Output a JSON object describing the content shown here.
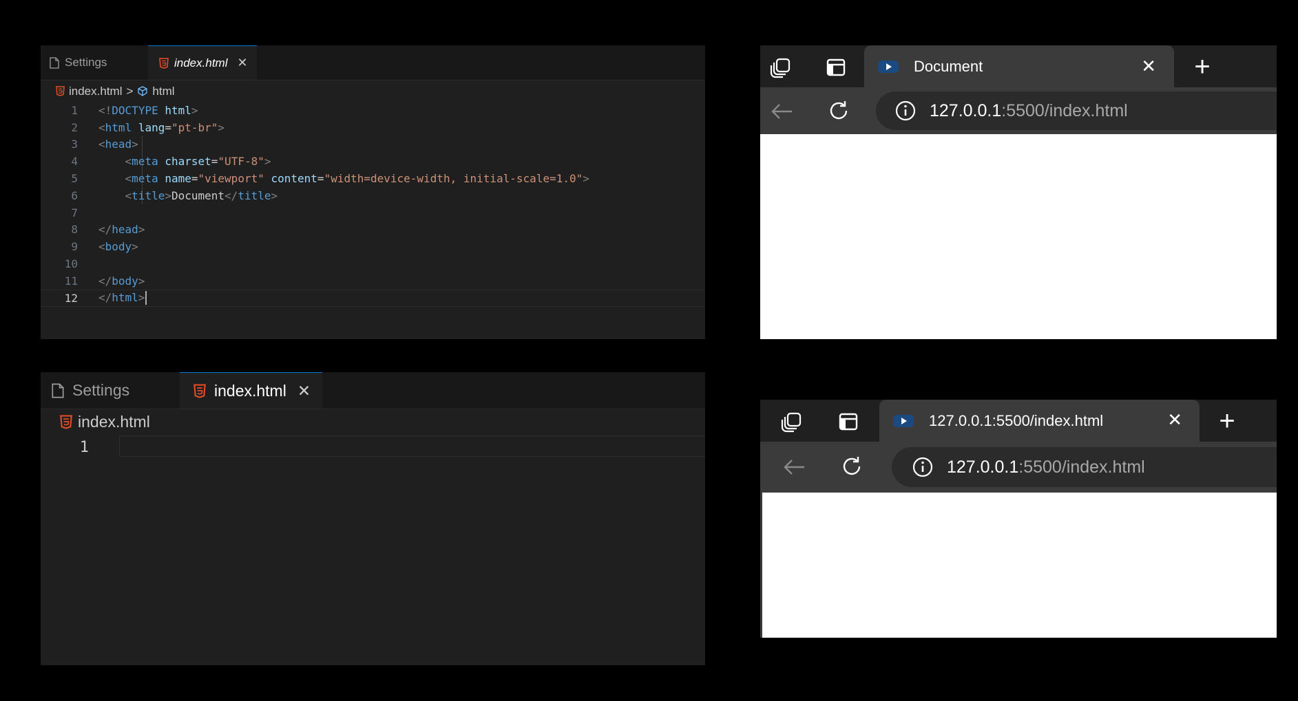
{
  "editor_top": {
    "tabs": [
      {
        "label": "Settings",
        "icon": "file-icon",
        "active": false
      },
      {
        "label": "index.html",
        "icon": "html5-icon",
        "active": true,
        "close": "✕"
      }
    ],
    "breadcrumb": {
      "file": "index.html",
      "separator": ">",
      "element": "html"
    },
    "lines": [
      {
        "n": "1",
        "code": "<!DOCTYPE html>"
      },
      {
        "n": "2",
        "code": "<html lang=\"pt-br\">"
      },
      {
        "n": "3",
        "code": "<head>"
      },
      {
        "n": "4",
        "code": "    <meta charset=\"UTF-8\">"
      },
      {
        "n": "5",
        "code": "    <meta name=\"viewport\" content=\"width=device-width, initial-scale=1.0\">"
      },
      {
        "n": "6",
        "code": "    <title>Document</title>"
      },
      {
        "n": "7",
        "code": ""
      },
      {
        "n": "8",
        "code": "</head>"
      },
      {
        "n": "9",
        "code": "<body>"
      },
      {
        "n": "10",
        "code": ""
      },
      {
        "n": "11",
        "code": "</body>"
      },
      {
        "n": "12",
        "code": "</html>"
      }
    ],
    "current_line": "12"
  },
  "editor_bottom": {
    "tabs": [
      {
        "label": "Settings",
        "icon": "file-icon",
        "active": false
      },
      {
        "label": "index.html",
        "icon": "html5-icon",
        "active": true,
        "close": "✕"
      }
    ],
    "breadcrumb": {
      "file": "index.html"
    },
    "lines": [
      {
        "n": "1",
        "code": ""
      }
    ]
  },
  "browser_top": {
    "tab_title": "Document",
    "tab_close": "✕",
    "new_tab": "+",
    "url_host": "127.0.0.1",
    "url_rest": ":5500/index.html"
  },
  "browser_bottom": {
    "tab_title": "127.0.0.1:5500/index.html",
    "tab_close": "✕",
    "new_tab": "+",
    "url_host": "127.0.0.1",
    "url_rest": ":5500/index.html"
  },
  "colors": {
    "editor_bg": "#1f1f1f",
    "tab_bar_bg": "#181818",
    "html_icon": "#e44d26",
    "browser_chrome": "#202020",
    "browser_toolbar": "#3b3b3b",
    "tag_blue": "#569cd6",
    "attr_name": "#9cdcfe",
    "attr_value": "#ce9178"
  }
}
